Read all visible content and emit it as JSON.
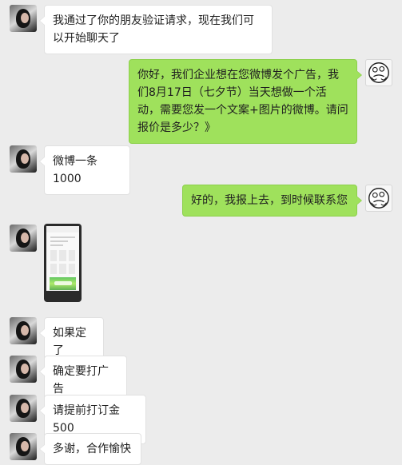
{
  "messages": [
    {
      "side": "left",
      "text": "我通过了你的朋友验证请求，现在我们可以开始聊天了"
    },
    {
      "side": "right",
      "text": "你好，我们企业想在您微博发个广告，我们8月17日（七夕节）当天想做一个活动，需要您发一个文案+图片的微博。请问报价是多少？》"
    },
    {
      "side": "left",
      "text": "微博一条1000"
    },
    {
      "side": "right",
      "text": "好的，我报上去，到时候联系您"
    },
    {
      "side": "left",
      "text": "如果定了"
    },
    {
      "side": "left",
      "text": "确定要打广告"
    },
    {
      "side": "left",
      "text": "请提前打订金500"
    },
    {
      "side": "left",
      "text": "多谢，合作愉快"
    }
  ]
}
